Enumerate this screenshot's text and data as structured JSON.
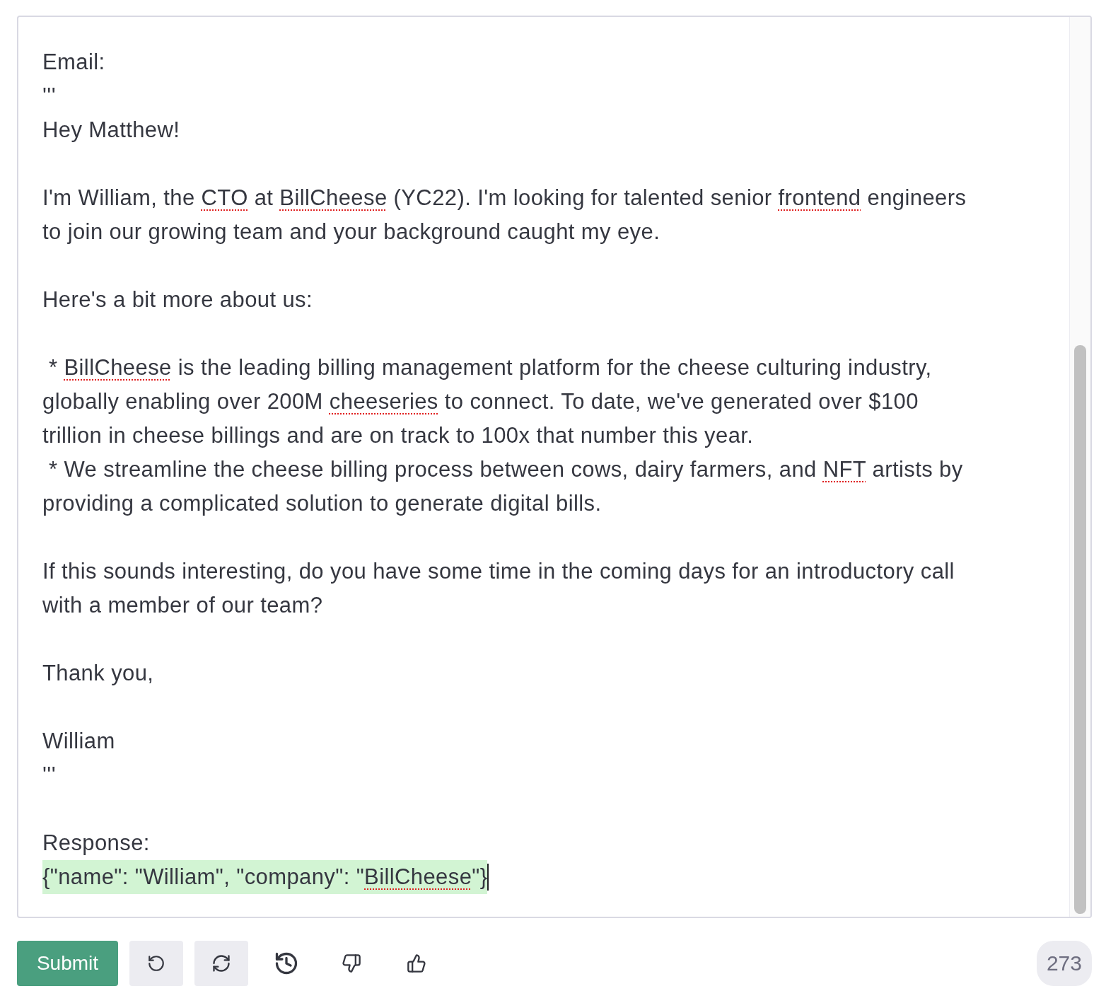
{
  "editor": {
    "paragraphs": [
      {
        "lines": [
          [
            {
              "text": "Email:",
              "misspelled": false
            }
          ],
          [
            {
              "text": "'''",
              "misspelled": false
            }
          ],
          [
            {
              "text": "Hey Matthew!",
              "misspelled": false
            }
          ]
        ]
      },
      {
        "lines": [
          [
            {
              "text": "I'm William, the ",
              "misspelled": false
            },
            {
              "text": "CTO",
              "misspelled": true
            },
            {
              "text": " at ",
              "misspelled": false
            },
            {
              "text": "BillCheese",
              "misspelled": true
            },
            {
              "text": " (YC22). I'm looking for talented senior ",
              "misspelled": false
            },
            {
              "text": "frontend",
              "misspelled": true
            },
            {
              "text": " engineers",
              "misspelled": false
            }
          ],
          [
            {
              "text": "to join our growing team and your background caught my eye.",
              "misspelled": false
            }
          ]
        ]
      },
      {
        "lines": [
          [
            {
              "text": "Here's a bit more about us:",
              "misspelled": false
            }
          ]
        ]
      },
      {
        "lines": [
          [
            {
              "text": " * ",
              "misspelled": false
            },
            {
              "text": "BillCheese",
              "misspelled": true
            },
            {
              "text": " is the leading billing management platform for the cheese culturing industry,",
              "misspelled": false
            }
          ],
          [
            {
              "text": "globally enabling over 200M ",
              "misspelled": false
            },
            {
              "text": "cheeseries",
              "misspelled": true
            },
            {
              "text": " to connect. To date, we've generated over $100",
              "misspelled": false
            }
          ],
          [
            {
              "text": "trillion in cheese billings and are on track to 100x that number this year.",
              "misspelled": false
            }
          ],
          [
            {
              "text": " * We streamline the cheese billing process between cows, dairy farmers, and ",
              "misspelled": false
            },
            {
              "text": "NFT",
              "misspelled": true
            },
            {
              "text": " artists by",
              "misspelled": false
            }
          ],
          [
            {
              "text": "providing a complicated solution to generate digital bills.",
              "misspelled": false
            }
          ]
        ]
      },
      {
        "lines": [
          [
            {
              "text": "If this sounds interesting, do you have some time in the coming days for an introductory call",
              "misspelled": false
            }
          ],
          [
            {
              "text": "with a member of our team?",
              "misspelled": false
            }
          ]
        ]
      },
      {
        "lines": [
          [
            {
              "text": "Thank you,",
              "misspelled": false
            }
          ]
        ]
      },
      {
        "lines": [
          [
            {
              "text": "William",
              "misspelled": false
            }
          ],
          [
            {
              "text": "'''",
              "misspelled": false
            }
          ]
        ]
      },
      {
        "lines": [
          [
            {
              "text": "Response:",
              "misspelled": false
            }
          ]
        ]
      }
    ],
    "completion": {
      "highlighted": true,
      "segments": [
        {
          "text": "{\"name\": \"William\", \"company\": \"",
          "misspelled": false
        },
        {
          "text": "BillCheese",
          "misspelled": true
        },
        {
          "text": "\"}",
          "misspelled": false
        }
      ]
    }
  },
  "toolbar": {
    "submit": "Submit",
    "token_count": "273"
  }
}
